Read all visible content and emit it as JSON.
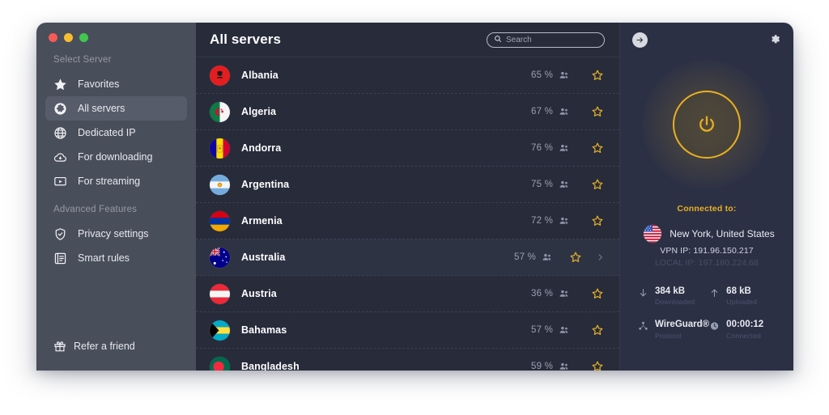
{
  "window": {
    "traffic_lights": [
      "close",
      "minimize",
      "maximize"
    ]
  },
  "sidebar": {
    "caption_1": "Select Server",
    "caption_2": "Advanced Features",
    "items": [
      {
        "label": "Favorites",
        "icon": "star-icon",
        "active": false
      },
      {
        "label": "All servers",
        "icon": "globe-icon",
        "active": true
      },
      {
        "label": "Dedicated IP",
        "icon": "dedicated-ip-icon",
        "active": false
      },
      {
        "label": "For downloading",
        "icon": "cloud-download-icon",
        "active": false
      },
      {
        "label": "For streaming",
        "icon": "streaming-icon",
        "active": false
      }
    ],
    "advanced_items": [
      {
        "label": "Privacy settings",
        "icon": "shield-check-icon",
        "active": false
      },
      {
        "label": "Smart rules",
        "icon": "rules-icon",
        "active": false
      }
    ],
    "refer": {
      "label": "Refer a friend",
      "icon": "gift-icon"
    }
  },
  "main": {
    "title": "All servers",
    "search": {
      "placeholder": "Search",
      "value": "",
      "icon": "search-icon"
    },
    "servers": [
      {
        "name": "Albania",
        "load": "65 %",
        "flag": "albania",
        "hover": false
      },
      {
        "name": "Algeria",
        "load": "67 %",
        "flag": "algeria",
        "hover": false
      },
      {
        "name": "Andorra",
        "load": "76 %",
        "flag": "andorra",
        "hover": false
      },
      {
        "name": "Argentina",
        "load": "75 %",
        "flag": "argentina",
        "hover": false
      },
      {
        "name": "Armenia",
        "load": "72 %",
        "flag": "armenia",
        "hover": false
      },
      {
        "name": "Australia",
        "load": "57 %",
        "flag": "australia",
        "hover": true
      },
      {
        "name": "Austria",
        "load": "36 %",
        "flag": "austria",
        "hover": false
      },
      {
        "name": "Bahamas",
        "load": "57 %",
        "flag": "bahamas",
        "hover": false
      },
      {
        "name": "Bangladesh",
        "load": "59 %",
        "flag": "bangladesh",
        "hover": false
      }
    ]
  },
  "panel": {
    "back_icon": "arrow-right-icon",
    "settings_icon": "gear-icon",
    "power_icon": "power-icon",
    "accent_color": "#e9b01f",
    "connected_label": "Connected to:",
    "location": "New York, United States",
    "location_flag": "usa",
    "vpn_ip": "VPN IP: 191.96.150.217",
    "local_ip": "LOCAL IP: 197.180.224.68",
    "stats": [
      {
        "value": "384 kB",
        "label": "Downloaded",
        "icon": "arrow-down-icon"
      },
      {
        "value": "68 kB",
        "label": "Uploaded",
        "icon": "arrow-up-icon"
      },
      {
        "value": "WireGuard®",
        "label": "Protocol",
        "icon": "protocol-icon"
      },
      {
        "value": "00:00:12",
        "label": "Connected",
        "icon": "clock-icon"
      }
    ]
  }
}
